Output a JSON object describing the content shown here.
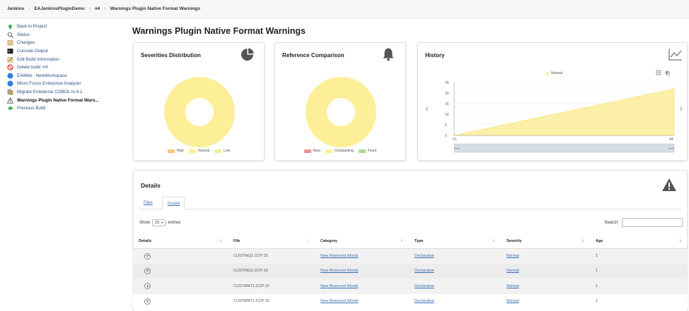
{
  "breadcrumb": [
    "Jenkins",
    "EAJenkinsPluginDemo",
    "#4",
    "Warnings Plugin Native Format Warnings"
  ],
  "sidebar": {
    "items": [
      {
        "label": "Back to Project",
        "icon": "arrow-up-icon",
        "color": "#3fae49"
      },
      {
        "label": "Status",
        "icon": "magnifier-icon",
        "color": "#6b7a8c"
      },
      {
        "label": "Changes",
        "icon": "notepad-icon",
        "color": "#c8a45a"
      },
      {
        "label": "Console Output",
        "icon": "terminal-icon",
        "color": "#333333"
      },
      {
        "label": "Edit Build Information",
        "icon": "notepad-edit-icon",
        "color": "#c8a45a"
      },
      {
        "label": "Delete build '#4'",
        "icon": "no-entry-icon",
        "color": "#d9342b"
      },
      {
        "label": "EAWeb - NewWorkspace",
        "icon": "globe-icon",
        "color": "#2f7fd6"
      },
      {
        "label": "Micro Focus Enterprise Analyzer",
        "icon": "globe-icon",
        "color": "#2f7fd6"
      },
      {
        "label": "Migrate Enterprise COBOL to 6.1",
        "icon": "migrate-icon",
        "color": "#7a7a7a"
      },
      {
        "label": "Warnings Plugin Native Format Warn...",
        "icon": "warning-icon",
        "color": "#555555",
        "active": true
      },
      {
        "label": "Previous Build",
        "icon": "arrow-left-icon",
        "color": "#3fae49"
      }
    ]
  },
  "page_title": "Warnings Plugin Native Format Warnings",
  "severities": {
    "title": "Severities Distribution",
    "legend": [
      {
        "label": "High",
        "color": "#f9c878"
      },
      {
        "label": "Normal",
        "color": "#fdf08f"
      },
      {
        "label": "Low",
        "color": "#e8f19a"
      }
    ],
    "ring_color": "#fcef98",
    "distribution": [
      {
        "label": "Normal",
        "share": 1.0
      }
    ]
  },
  "reference": {
    "title": "Reference Comparison",
    "legend": [
      {
        "label": "New",
        "color": "#ef9090"
      },
      {
        "label": "Outstanding",
        "color": "#fdf08f"
      },
      {
        "label": "Fixed",
        "color": "#a7d98e"
      }
    ],
    "ring_color": "#fcef98",
    "distribution": [
      {
        "label": "Outstanding",
        "share": 1.0
      }
    ]
  },
  "history": {
    "title": "History",
    "legend_label": "Normal",
    "area_color": "#fcf0a8",
    "left_arrow": "‹",
    "right_arrow": "›",
    "slider_left": "⟺",
    "slider_right": "⟺"
  },
  "chart_data": {
    "type": "area",
    "x": [
      "#1",
      "#4"
    ],
    "series": [
      {
        "name": "Normal",
        "values": [
          0,
          22
        ]
      }
    ],
    "ylim": [
      0,
      25
    ],
    "yticks": [
      "25",
      "20",
      "15",
      "10",
      "5",
      "0"
    ],
    "xticks": [
      "#1",
      "#4"
    ],
    "grid": true,
    "legend_position": "top"
  },
  "details": {
    "title": "Details",
    "tabs": [
      "Files",
      "Issues"
    ],
    "show_label": "Show",
    "entries_value": "10",
    "entries_label": "entries",
    "search_label": "Search:",
    "search_value": "",
    "columns": [
      "Details",
      "File",
      "Category",
      "Type",
      "Severity",
      "Age"
    ],
    "rows": [
      {
        "file": "CUSTINQ1.CCP:15",
        "category": "New Reserved Words",
        "type": "Declaration",
        "severity": "Normal",
        "age": "1"
      },
      {
        "file": "CUSTINQ1.CCP:15",
        "category": "New Reserved Words",
        "type": "Declaration",
        "severity": "Normal",
        "age": "1"
      },
      {
        "file": "CUSTMNT1.CCP:15",
        "category": "New Reserved Words",
        "type": "Declaration",
        "severity": "Normal",
        "age": "1"
      },
      {
        "file": "CUSTMNT1.CCP:15",
        "category": "New Reserved Words",
        "type": "Declaration",
        "severity": "Normal",
        "age": "1"
      }
    ]
  }
}
